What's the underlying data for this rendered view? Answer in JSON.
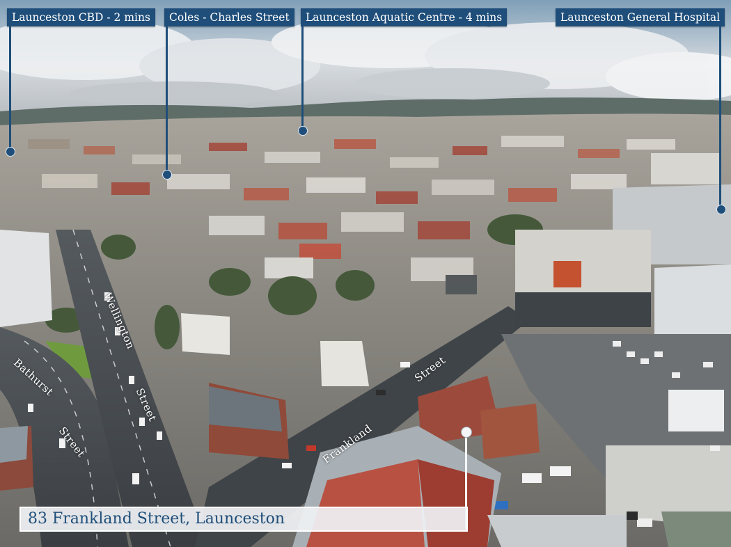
{
  "photo": {
    "subject": "83 Frankland Street, Launceston",
    "palette": {
      "sky_top": "#7f9fb8",
      "sky_mid": "#d9dde1",
      "cloud": "#f2f3f4",
      "hills": "#5b6a63",
      "town_far": "#a9a49a",
      "roofs_red": "#a3473a",
      "roofs_grey": "#8e979c",
      "road": "#3d4247",
      "trees": "#45593a",
      "grass": "#6f9b3e"
    }
  },
  "points_of_interest": [
    {
      "label": "Launceston CBD - 2 mins"
    },
    {
      "label": "Coles - Charles Street"
    },
    {
      "label": "Launceston Aquatic Centre - 4 mins"
    },
    {
      "label": "Launceston  General Hospital"
    }
  ],
  "streets": {
    "bathurst": "Bathurst",
    "bathurst_suffix": "Street",
    "wellington": "Wellington",
    "wellington_suffix": "Street",
    "frankland": "Frankland",
    "frankland_suffix": "Street"
  },
  "address_callout": {
    "text": "83 Frankland Street, Launceston"
  },
  "colors": {
    "label_bg": "#1f4e7a",
    "label_text": "#ffffff",
    "address_text": "#1f4e7a"
  }
}
